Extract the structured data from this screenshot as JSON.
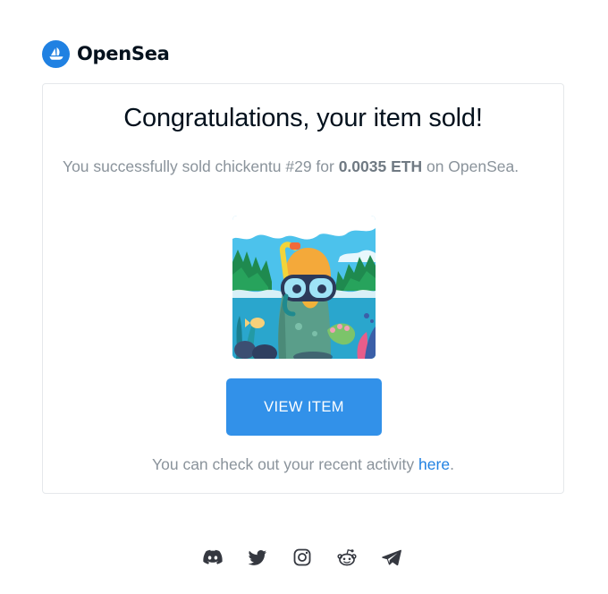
{
  "brand": {
    "name": "OpenSea",
    "color": "#2081E2",
    "logo_icon": "opensea-boat-icon"
  },
  "card": {
    "title": "Congratulations, your item sold!",
    "message": {
      "prefix": "You successfully sold chickentu #29 for ",
      "price": "0.0035 ETH",
      "suffix": " on OpenSea."
    },
    "item_image": {
      "icon": "nft-snorkel-duck-image",
      "item_name": "chickentu #29"
    },
    "button_label": "VIEW ITEM",
    "button_color": "#3291e9",
    "activity": {
      "prefix": "You can check out your recent activity ",
      "link_text": "here",
      "suffix": "."
    }
  },
  "socials": [
    {
      "name": "discord-icon"
    },
    {
      "name": "twitter-icon"
    },
    {
      "name": "instagram-icon"
    },
    {
      "name": "reddit-icon"
    },
    {
      "name": "telegram-icon"
    }
  ]
}
